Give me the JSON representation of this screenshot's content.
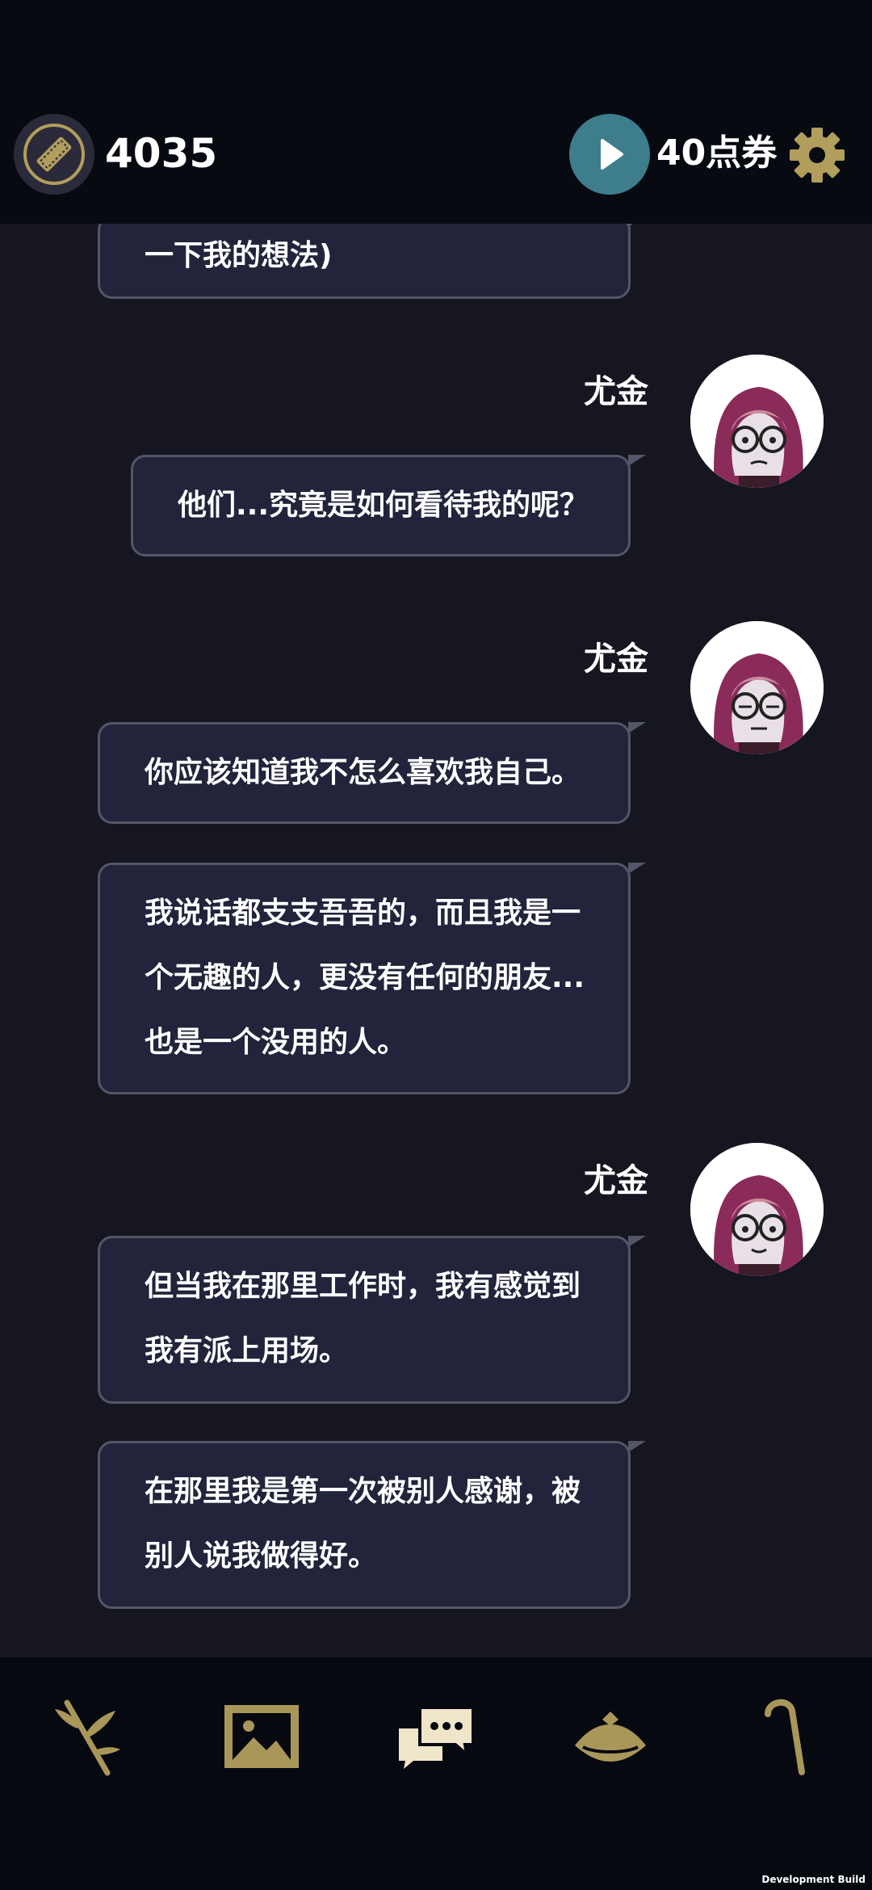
{
  "header": {
    "ticket_count": "4035",
    "points_label": "40点券"
  },
  "messages": [
    {
      "speaker": "",
      "lines": [
        "一下我的想法)"
      ]
    },
    {
      "speaker": "尤金",
      "lines": [
        "他们...究竟是如何看待我的呢？"
      ]
    },
    {
      "speaker": "尤金",
      "lines": [
        "你应该知道我不怎么喜欢我自己。"
      ]
    },
    {
      "speaker": "",
      "lines": [
        "我说话都支支吾吾的，而且我是一",
        "个无趣的人，更没有任何的朋友...",
        "也是一个没用的人。"
      ]
    },
    {
      "speaker": "尤金",
      "lines": [
        "但当我在那里工作时，我有感觉到",
        "我有派上用场。"
      ]
    },
    {
      "speaker": "",
      "lines": [
        "在那里我是第一次被别人感谢，被",
        "别人说我做得好。"
      ]
    }
  ],
  "nav": {
    "items": [
      "branch-icon",
      "gallery-icon",
      "chat-icon",
      "hat-icon",
      "cane-icon"
    ]
  },
  "footer": {
    "build_label": "Development Build"
  },
  "colors": {
    "background": "#151620",
    "bubble": "#22243b",
    "bubble_border": "#545566",
    "accent_gold": "#a9975a",
    "play_button": "#3d7d8c"
  }
}
